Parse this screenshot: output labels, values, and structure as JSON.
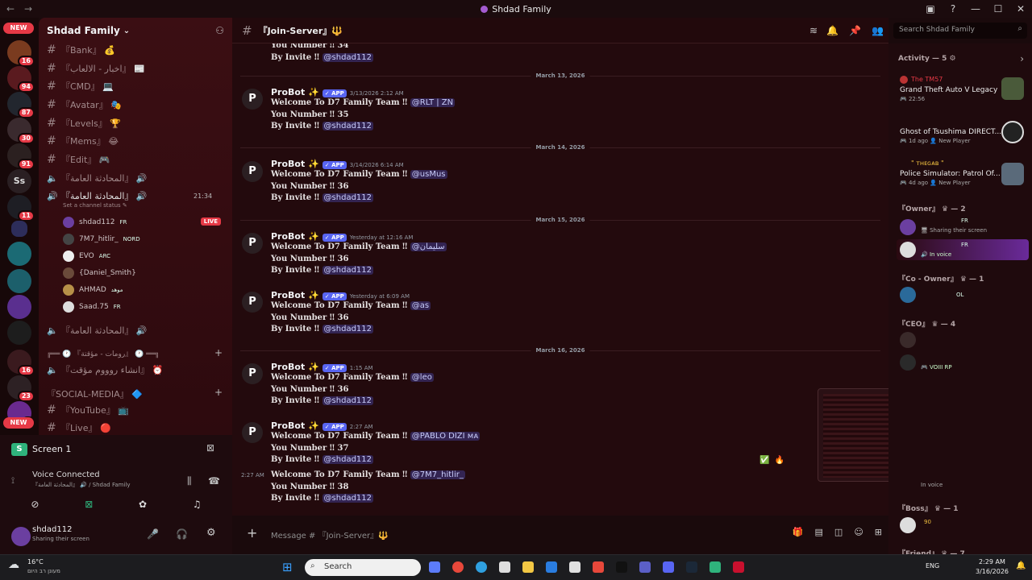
{
  "window": {
    "title": "Shdad Family",
    "back": "←",
    "forward": "→"
  },
  "rail": {
    "new_badge_top": "NEW",
    "new_badge_bottom": "NEW",
    "badges": [
      "16",
      "94",
      "87",
      "30",
      "91",
      "11",
      "16",
      "23",
      "2"
    ],
    "ss_label": "Ss"
  },
  "server": {
    "name": "Shdad Family",
    "chevron": "⌄"
  },
  "channels": [
    {
      "name": "『Bank』 💰",
      "type": "text"
    },
    {
      "name": "『اخبار - الالعاب』 📰",
      "type": "text"
    },
    {
      "name": "『CMD』 💻",
      "type": "text"
    },
    {
      "name": "『Avatar』 🎭",
      "type": "text"
    },
    {
      "name": "『Levels』 🏆",
      "type": "text"
    },
    {
      "name": "『Mems』 😂",
      "type": "text"
    },
    {
      "name": "『Edit』 🎮",
      "type": "text"
    },
    {
      "name": "『المحادثة العامة』 🔊",
      "type": "voice"
    },
    {
      "name": "『المحادثة العامة』 🔊",
      "type": "voice",
      "time": "21:34",
      "status": "Set a channel status ✎"
    }
  ],
  "voice_users": [
    {
      "name": "shdad112",
      "tag": "FR",
      "live": "LIVE"
    },
    {
      "name": "7M7_hitlir_",
      "tag": "NORD"
    },
    {
      "name": "EVO",
      "tag": "ARC"
    },
    {
      "name": "{Daniel_Smith}",
      "tag": ""
    },
    {
      "name": "AHMAD",
      "tag": "موهد"
    },
    {
      "name": "Saad.75",
      "tag": "FR"
    }
  ],
  "channels_lower": [
    {
      "name": "『المحادثة العامة』 🔊",
      "type": "voice"
    },
    {
      "name": "╔══ 🕐 『رومات - مؤقتة』 🕐 ══╗",
      "type": "category"
    },
    {
      "name": "『انشاء روووم مؤقت』 ⏰",
      "type": "voice"
    },
    {
      "name": "『SOCIAL-MEDIA』 🔷",
      "type": "category"
    },
    {
      "name": "『YouTube』 📺",
      "type": "text"
    },
    {
      "name": "『Live』 🔴",
      "type": "text"
    }
  ],
  "screenshare": {
    "title": "Screen 1"
  },
  "voice": {
    "status": "Voice Connected",
    "channel": "『المحادثة العامة』 🔊 / Shdad Family"
  },
  "user": {
    "name": "shdad112",
    "status": "Sharing their screen"
  },
  "chat": {
    "channel": "『Join-Server』🔱",
    "placeholder": "Message # 『Join-Server』🔱",
    "top_partial": {
      "line1": "You Number ‼ 34",
      "line2": "By Invite ‼",
      "mention": "@shdad112"
    },
    "messages": [
      {
        "date": "March 13, 2026",
        "author": "ProBot ✨",
        "app": "✓ APP",
        "ts": "3/13/2026 2:12 AM",
        "welcome": "Welcome To D7 Family Team ‼",
        "who": "@RLT | ZN",
        "number": "You Number ‼ 35",
        "invite": "By Invite ‼",
        "by": "@shdad112"
      },
      {
        "date": "March 14, 2026",
        "author": "ProBot ✨",
        "app": "✓ APP",
        "ts": "3/14/2026 6:14 AM",
        "welcome": "Welcome To D7 Family Team ‼",
        "who": "@usMus",
        "number": "You Number ‼ 36",
        "invite": "By Invite ‼",
        "by": "@shdad112"
      },
      {
        "date": "March 15, 2026",
        "author": "ProBot ✨",
        "app": "✓ APP",
        "ts": "Yesterday at 12:16 AM",
        "welcome": "Welcome To D7 Family Team ‼",
        "who": "@سليمان",
        "number": "You Number ‼ 36",
        "invite": "By Invite ‼",
        "by": "@shdad112"
      },
      {
        "date": "",
        "author": "ProBot ✨",
        "app": "✓ APP",
        "ts": "Yesterday at 6:09 AM",
        "welcome": "Welcome To D7 Family Team ‼",
        "who": "@as",
        "number": "You Number ‼ 36",
        "invite": "By Invite ‼",
        "by": "@shdad112"
      },
      {
        "date": "March 16, 2026",
        "author": "ProBot ✨",
        "app": "✓ APP",
        "ts": "1:15 AM",
        "welcome": "Welcome To D7 Family Team ‼",
        "who": "@leo",
        "number": "You Number ‼ 36",
        "invite": "By Invite ‼",
        "by": "@shdad112"
      },
      {
        "date": "",
        "author": "ProBot ✨",
        "app": "✓ APP",
        "ts": "2:27 AM",
        "welcome": "Welcome To D7 Family Team ‼",
        "who": "@PABLO DIZI ᴍᴀ",
        "number": "You Number ‼ 37",
        "invite": "By Invite ‼",
        "by": "@shdad112"
      }
    ],
    "followup": {
      "ts": "2:27 AM",
      "welcome": "Welcome To D7 Family Team ‼",
      "who": "@7M7_hitlir_",
      "number": "You Number ‼ 38",
      "invite": "By Invite ‼",
      "by": "@shdad112"
    }
  },
  "search": {
    "placeholder": "Search Shdad Family"
  },
  "members": {
    "activity_header": "Activity — 5 ⚙",
    "activities": [
      {
        "user": "The TM57",
        "game": "Grand Theft Auto V Legacy",
        "meta": "🎮 22:56"
      },
      {
        "user": "",
        "game": "Ghost of Tsushima DIRECT...",
        "meta": "🎮 1d ago  👤 New Player"
      },
      {
        "user": "\" ᴛʜᴇɢᴀʙ \"",
        "game": "Police Simulator: Patrol Of...",
        "meta": "🎮 4d ago  👤 New Player"
      }
    ],
    "groups": [
      {
        "title": "『Owner』 ♛ — 2",
        "rows": [
          {
            "text": "🖥 Sharing their screen",
            "tag": "FR"
          },
          {
            "text": "🔊 In voice",
            "tag": "FR"
          }
        ]
      },
      {
        "title": "『Co - Owner』 ♛ — 1",
        "rows": [
          {
            "text": "",
            "tag": "OL"
          }
        ]
      },
      {
        "title": "『CEO』 ♛ — 4",
        "rows": [
          {
            "text": "",
            "tag": ""
          },
          {
            "text": "🎮 VOIII RP",
            "tag": ""
          }
        ]
      },
      {
        "title": "『Boss』 ♛ — 1",
        "rows": [
          {
            "text": "",
            "tag": "90"
          }
        ]
      },
      {
        "title": "『Friend』 ♛ — 7",
        "rows": []
      }
    ],
    "in_voice_partial": "In voice"
  },
  "taskbar": {
    "weather_temp": "16°C",
    "weather_desc": "מעונן רב היום",
    "search": "Search",
    "lang": "ENG",
    "time": "2:29 AM",
    "date": "3/16/2026"
  }
}
